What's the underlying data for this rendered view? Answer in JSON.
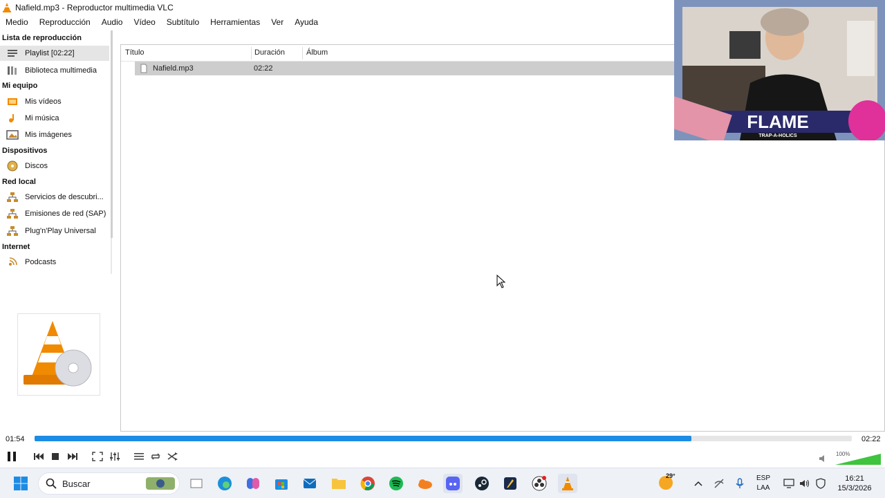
{
  "window": {
    "title": "Nafield.mp3 - Reproductor multimedia VLC"
  },
  "menu": [
    "Medio",
    "Reproducción",
    "Audio",
    "Vídeo",
    "Subtítulo",
    "Herramientas",
    "Ver",
    "Ayuda"
  ],
  "sidebar": {
    "sections": {
      "playlist": "Lista de reproducción",
      "mycomputer": "Mi equipo",
      "devices": "Dispositivos",
      "lan": "Red local",
      "internet": "Internet"
    },
    "items": {
      "playlist": "Playlist [02:22]",
      "library": "Biblioteca multimedia",
      "videos": "Mis vídeos",
      "music": "Mi música",
      "images": "Mis imágenes",
      "discs": "Discos",
      "discovery": "Servicios de descubri...",
      "sap": "Emisiones de red (SAP)",
      "upnp": "Plug'n'Play Universal",
      "podcasts": "Podcasts"
    }
  },
  "playlist": {
    "columns": {
      "title": "Título",
      "duration": "Duración",
      "album": "Álbum"
    },
    "rows": [
      {
        "title": "Nafield.mp3",
        "duration": "02:22",
        "album": ""
      }
    ]
  },
  "player": {
    "time_current": "01:54",
    "time_total": "02:22",
    "progress": 0.804,
    "volume_label": "100%",
    "volume": 1.0
  },
  "webcam": {
    "banner": "FLAME",
    "banner_sub": "TRAP-A-HOLICS"
  },
  "taskbar": {
    "search_label": "Buscar",
    "temp": "29°",
    "lang_line1": "ESP",
    "lang_line2": "LAA",
    "time": "16:21",
    "date": "15/3/2026"
  },
  "colors": {
    "accent": "#1c8ce4",
    "vlc_orange": "#f08a00",
    "volume_green": "#3ec43e"
  }
}
